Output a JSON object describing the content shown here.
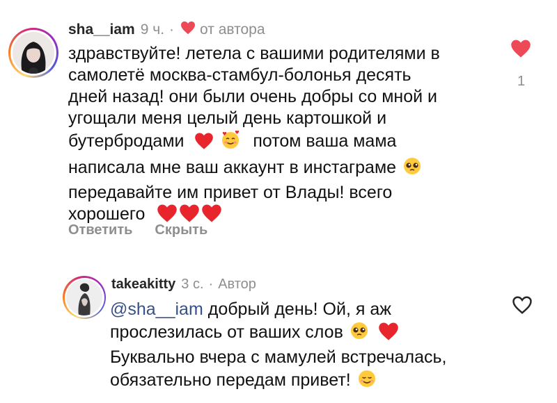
{
  "comments": [
    {
      "username": "sha__iam",
      "time": "9 ч.",
      "separator": "·",
      "author_badge": "от автора",
      "text_lines": [
        "здравствуйте! летела с вашими родителями в",
        "самолетё москва-стамбул-болонья десять",
        "дней назад! они были очень добры со мной и",
        "угощали меня целый день картошкой и",
        "бутербродами",
        "потом ваша мама",
        "написала мне ваш аккаунт в инстаграме",
        "передавайте им привет от Влады! всего",
        "хорошего"
      ],
      "like_count": "1",
      "liked_color": "#ed4956",
      "actions": {
        "reply": "Ответить",
        "hide": "Скрыть"
      }
    },
    {
      "username": "takeakitty",
      "time": "3 с.",
      "separator": "·",
      "author_badge": "Автор",
      "mention": "@sha__iam",
      "text_lines": [
        "добрый день! Ой, я аж",
        "прослезилась от ваших слов",
        "Буквально вчера с мамулей встречалась,",
        "обязательно передам привет!"
      ]
    }
  ],
  "emojis": {
    "heart": "red-heart",
    "smiling_hearts": "smiling-face-with-hearts",
    "pleading": "pleading-face",
    "relieved": "smiling-face"
  }
}
